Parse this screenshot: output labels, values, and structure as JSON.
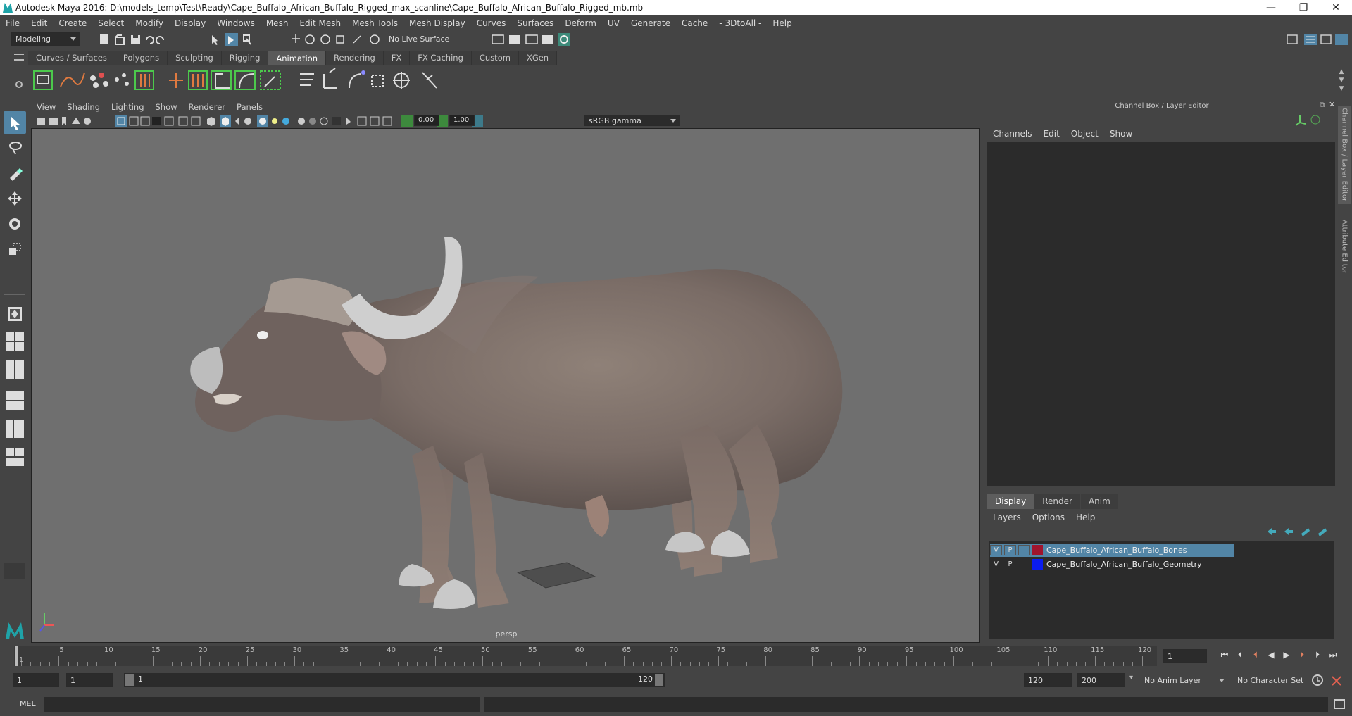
{
  "window": {
    "title": "Autodesk Maya 2016: D:\\models_temp\\Test\\Ready\\Cape_Buffalo_African_Buffalo_Rigged_max_scanline\\Cape_Buffalo_African_Buffalo_Rigged_mb.mb",
    "minimize": "—",
    "restore": "❐",
    "close": "✕"
  },
  "menubar": [
    "File",
    "Edit",
    "Create",
    "Select",
    "Modify",
    "Display",
    "Windows",
    "Mesh",
    "Edit Mesh",
    "Mesh Tools",
    "Mesh Display",
    "Curves",
    "Surfaces",
    "Deform",
    "UV",
    "Generate",
    "Cache",
    "- 3DtoAll -",
    "Help"
  ],
  "statusline": {
    "mode": "Modeling",
    "live_surface": "No Live Surface"
  },
  "shelf": {
    "tabs": [
      "Curves / Surfaces",
      "Polygons",
      "Sculpting",
      "Rigging",
      "Animation",
      "Rendering",
      "FX",
      "FX Caching",
      "Custom",
      "XGen"
    ],
    "active_tab": "Animation"
  },
  "viewport": {
    "menu": [
      "View",
      "Shading",
      "Lighting",
      "Show",
      "Renderer",
      "Panels"
    ],
    "exposure": "0.00",
    "gamma": "1.00",
    "color_space": "sRGB gamma",
    "camera": "persp"
  },
  "right_panel": {
    "title": "Channel Box / Layer Editor",
    "menu": [
      "Channels",
      "Edit",
      "Object",
      "Show"
    ],
    "side_tabs": [
      "Channel Box / Layer Editor",
      "Attribute Editor"
    ],
    "layer_tabs": [
      "Display",
      "Render",
      "Anim"
    ],
    "active_layer_tab": "Display",
    "layer_menu": [
      "Layers",
      "Options",
      "Help"
    ],
    "layers": [
      {
        "v": "V",
        "p": "P",
        "color": "#a0142d",
        "name": "Cape_Buffalo_African_Buffalo_Bones",
        "selected": true
      },
      {
        "v": "V",
        "p": "P",
        "color": "#0a1cf0",
        "name": "Cape_Buffalo_African_Buffalo_Geometry",
        "selected": false
      }
    ]
  },
  "timeline": {
    "start_label": "1",
    "ticks": [
      "5",
      "10",
      "15",
      "20",
      "25",
      "30",
      "35",
      "40",
      "45",
      "50",
      "55",
      "60",
      "65",
      "70",
      "75",
      "80",
      "85",
      "90",
      "95",
      "100",
      "105",
      "110",
      "115",
      "120"
    ],
    "current_frame": "1"
  },
  "range": {
    "start": "1",
    "playback_start": "1",
    "slider_start": "1",
    "slider_end": "120",
    "playback_end": "120",
    "end": "200",
    "anim_layer": "No Anim Layer",
    "character_set": "No Character Set"
  },
  "command_line": {
    "label": "MEL"
  },
  "colors": {
    "accent_blue": "#5285a6",
    "viewport_bg": "#6f6f6f",
    "selected_layer": "#5285a6"
  }
}
